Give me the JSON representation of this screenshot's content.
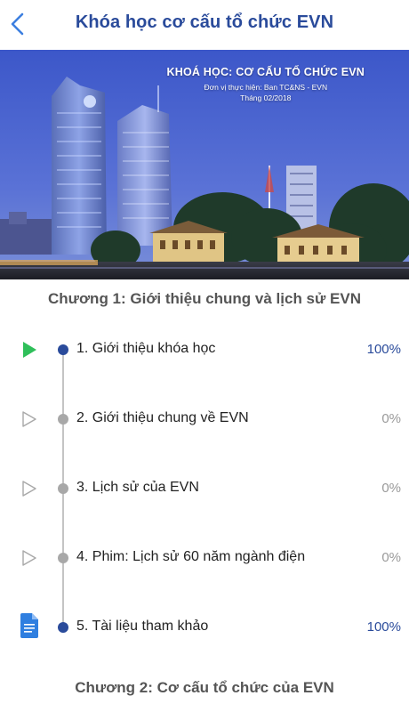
{
  "header": {
    "title": "Khóa học cơ cấu tổ chức EVN",
    "back_icon": "chevron-left-icon"
  },
  "banner": {
    "heading": "KHOÁ HỌC: CƠ CẤU TỔ CHỨC EVN",
    "line1": "Đơn vị thực hiện: Ban TC&NS - EVN",
    "line2": "Tháng 02/2018"
  },
  "chapter1": {
    "title": "Chương 1: Giới thiệu chung và lịch sử EVN",
    "lessons": [
      {
        "label": "1. Giới thiệu khóa học",
        "percent": "100%",
        "icon": "play-filled-icon",
        "status": "done"
      },
      {
        "label": "2. Giới thiệu chung về EVN",
        "percent": "0%",
        "icon": "play-outline-icon",
        "status": "todo"
      },
      {
        "label": "3. Lịch sử của EVN",
        "percent": "0%",
        "icon": "play-outline-icon",
        "status": "todo"
      },
      {
        "label": "4. Phim: Lịch sử 60 năm ngành điện",
        "percent": "0%",
        "icon": "play-outline-icon",
        "status": "todo"
      },
      {
        "label": "5. Tài liệu tham khảo",
        "percent": "100%",
        "icon": "document-icon",
        "status": "done"
      }
    ]
  },
  "chapter2": {
    "title": "Chương 2: Cơ cấu tổ chức của EVN"
  },
  "colors": {
    "accent": "#2a4b9b",
    "play_active": "#2fbf5a",
    "inactive": "#a8a8a8",
    "document": "#2f7fe0"
  }
}
